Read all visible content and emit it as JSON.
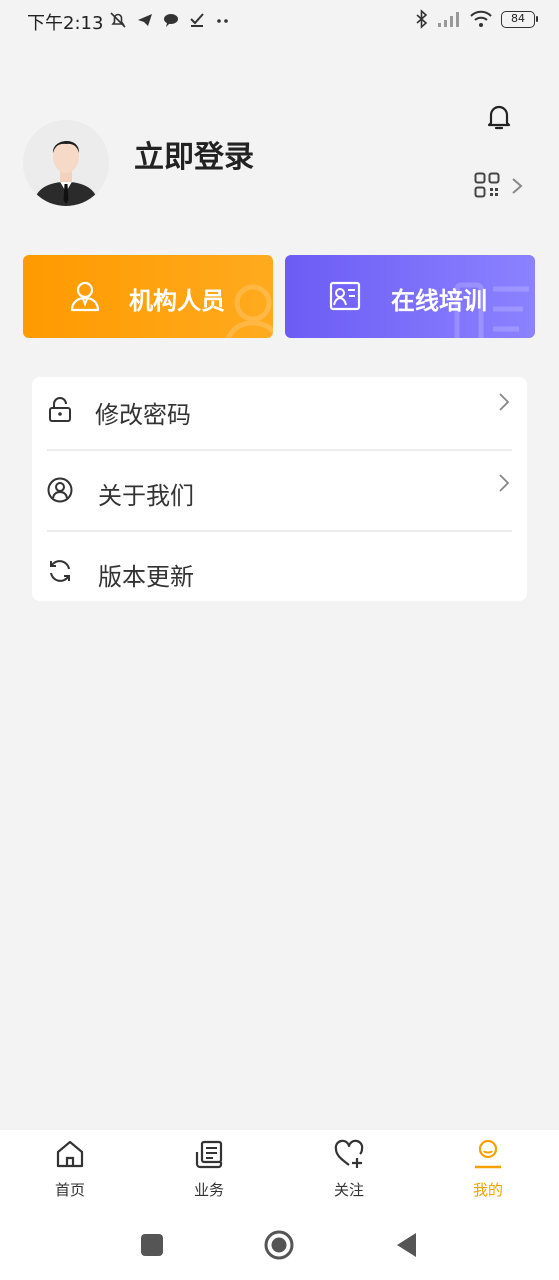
{
  "status_bar": {
    "time": "下午2:13",
    "battery": "84"
  },
  "profile": {
    "login_text": "立即登录"
  },
  "role_cards": [
    {
      "label": "机构人员",
      "color": "#ff9a00"
    },
    {
      "label": "在线培训",
      "color": "#6c5cf5"
    }
  ],
  "menu": {
    "items": [
      {
        "label": "修改密码",
        "icon": "lock-icon",
        "has_chevron": true
      },
      {
        "label": "关于我们",
        "icon": "user-circle-icon",
        "has_chevron": true
      },
      {
        "label": "版本更新",
        "icon": "refresh-icon",
        "has_chevron": false
      }
    ]
  },
  "tabbar": {
    "tabs": [
      {
        "label": "首页",
        "icon": "home-icon"
      },
      {
        "label": "业务",
        "icon": "business-icon"
      },
      {
        "label": "关注",
        "icon": "heart-plus-icon"
      },
      {
        "label": "我的",
        "icon": "profile-icon",
        "active": true
      }
    ],
    "active_color": "#f5a100"
  }
}
